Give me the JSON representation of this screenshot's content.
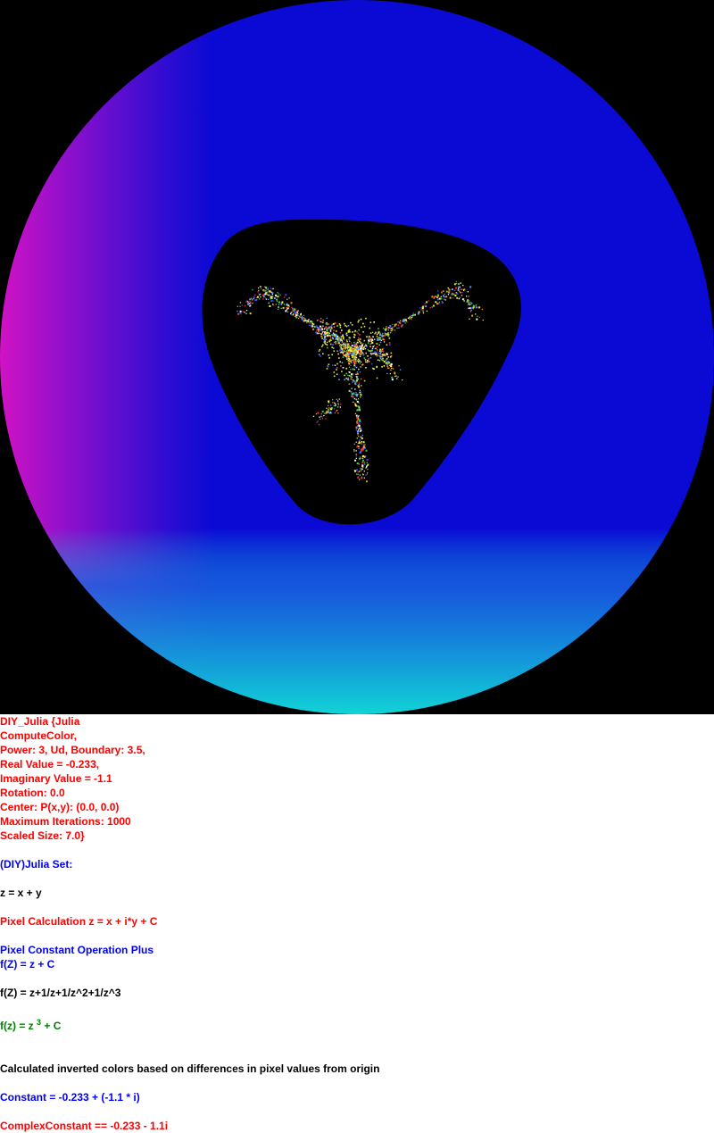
{
  "colors": {
    "background": "#000000",
    "disc_blue": "#0a0ad4",
    "disc_magenta": "#cc14c8",
    "disc_cyan": "#11d2d8",
    "text_red": "#ff0000",
    "text_blue": "#0000ff",
    "text_black": "#000000",
    "text_green": "#008000"
  },
  "info": {
    "header_lines": [
      "DIY_Julia {Julia",
      "ComputeColor,",
      "Power: 3, Ud, Boundary: 3.5,",
      "Real Value = -0.233,",
      "Imaginary Value = -1.1",
      "Rotation: 0.0",
      "Center: P(x,y): (0.0, 0.0)",
      "Maximum Iterations: 1000",
      "Scaled Size: 7.0}"
    ],
    "set_title": "(DIY)Julia Set:",
    "z_def": "z = x + y",
    "pixel_calc": "Pixel Calculation z = x + i*y + C",
    "pixel_op": "Pixel Constant Operation Plus",
    "fz_plus": "f(Z) = z + C",
    "fz_series": "f(Z) = z+1/z+1/z^2+1/z^3",
    "fz_power_prefix": "f(z) = z ",
    "fz_power_exp": "3",
    "fz_power_suffix": " + C",
    "color_note": "Calculated inverted colors based on differences in pixel values from origin",
    "constant": "Constant = -0.233 + (-1.1 * i)",
    "complex_constant": "ComplexConstant == -0.233 - 1.1i"
  }
}
